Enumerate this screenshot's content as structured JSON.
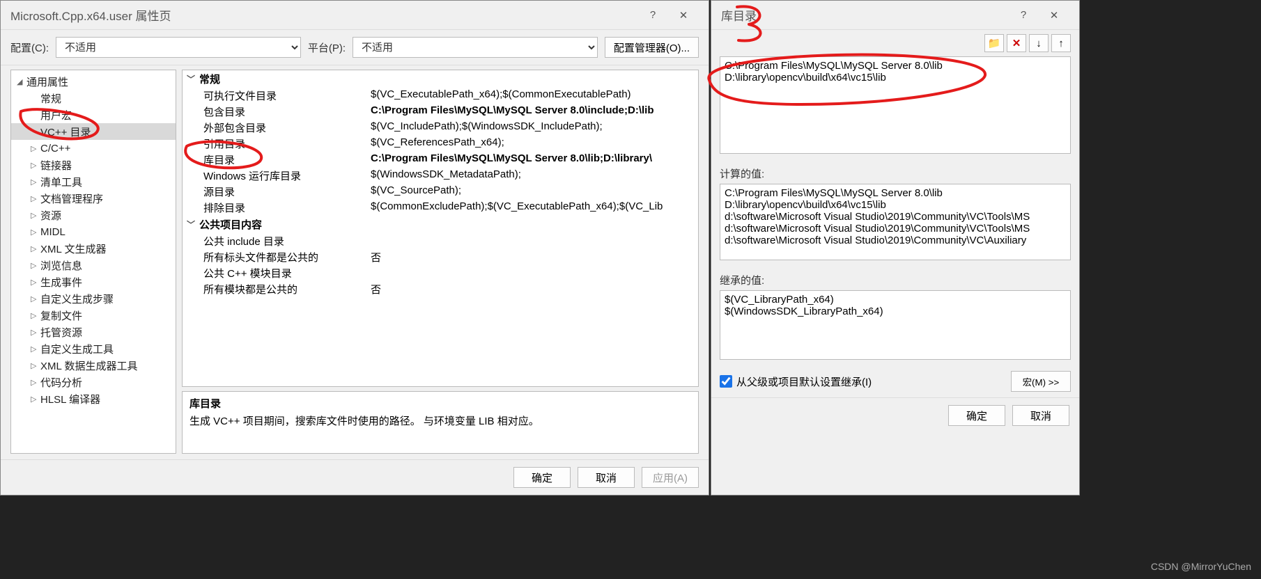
{
  "leftDialog": {
    "title": "Microsoft.Cpp.x64.user 属性页",
    "help": "?",
    "close": "✕",
    "configLabel": "配置(C):",
    "configValue": "不适用",
    "platformLabel": "平台(P):",
    "platformValue": "不适用",
    "configMgr": "配置管理器(O)...",
    "tree": {
      "root": "通用属性",
      "items": [
        "常规",
        "用户宏",
        "VC++ 目录",
        "C/C++",
        "链接器",
        "清单工具",
        "文档管理程序",
        "资源",
        "MIDL",
        "XML 文生成器",
        "浏览信息",
        "生成事件",
        "自定义生成步骤",
        "复制文件",
        "托管资源",
        "自定义生成工具",
        "XML 数据生成器工具",
        "代码分析",
        "HLSL 编译器"
      ],
      "selectedIndex": 2
    },
    "groups": [
      {
        "label": "常规",
        "rows": [
          {
            "k": "可执行文件目录",
            "v": "$(VC_ExecutablePath_x64);$(CommonExecutablePath)"
          },
          {
            "k": "包含目录",
            "v": "C:\\Program Files\\MySQL\\MySQL Server 8.0\\include;D:\\lib",
            "bold": true
          },
          {
            "k": "外部包含目录",
            "v": "$(VC_IncludePath);$(WindowsSDK_IncludePath);"
          },
          {
            "k": "引用目录",
            "v": "$(VC_ReferencesPath_x64);"
          },
          {
            "k": "库目录",
            "v": "C:\\Program Files\\MySQL\\MySQL Server 8.0\\lib;D:\\library\\",
            "bold": true
          },
          {
            "k": "Windows 运行库目录",
            "v": "$(WindowsSDK_MetadataPath);"
          },
          {
            "k": "源目录",
            "v": "$(VC_SourcePath);"
          },
          {
            "k": "排除目录",
            "v": "$(CommonExcludePath);$(VC_ExecutablePath_x64);$(VC_Lib"
          }
        ]
      },
      {
        "label": "公共项目内容",
        "rows": [
          {
            "k": "公共 include 目录",
            "v": ""
          },
          {
            "k": "所有标头文件都是公共的",
            "v": "否"
          },
          {
            "k": "公共 C++ 模块目录",
            "v": ""
          },
          {
            "k": "所有模块都是公共的",
            "v": "否"
          }
        ]
      }
    ],
    "desc": {
      "title": "库目录",
      "text": "生成 VC++ 项目期间，搜索库文件时使用的路径。 与环境变量 LIB 相对应。"
    },
    "footer": {
      "ok": "确定",
      "cancel": "取消",
      "apply": "应用(A)"
    }
  },
  "rightDialog": {
    "title": "库目录",
    "close": "✕",
    "editLines": "C:\\Program Files\\MySQL\\MySQL Server 8.0\\lib\nD:\\library\\opencv\\build\\x64\\vc15\\lib",
    "computedLabel": "计算的值:",
    "computedLines": "C:\\Program Files\\MySQL\\MySQL Server 8.0\\lib\nD:\\library\\opencv\\build\\x64\\vc15\\lib\nd:\\software\\Microsoft Visual Studio\\2019\\Community\\VC\\Tools\\MS\nd:\\software\\Microsoft Visual Studio\\2019\\Community\\VC\\Tools\\MS\nd:\\software\\Microsoft Visual Studio\\2019\\Community\\VC\\Auxiliary",
    "inheritedLabel": "继承的值:",
    "inheritedLines": "$(VC_LibraryPath_x64)\n$(WindowsSDK_LibraryPath_x64)",
    "inheritCheck": "从父级或项目默认设置继承(I)",
    "macroBtn": "宏(M) >>",
    "footer": {
      "ok": "确定",
      "cancel": "取消"
    }
  },
  "watermark": "CSDN @MirrorYuChen"
}
